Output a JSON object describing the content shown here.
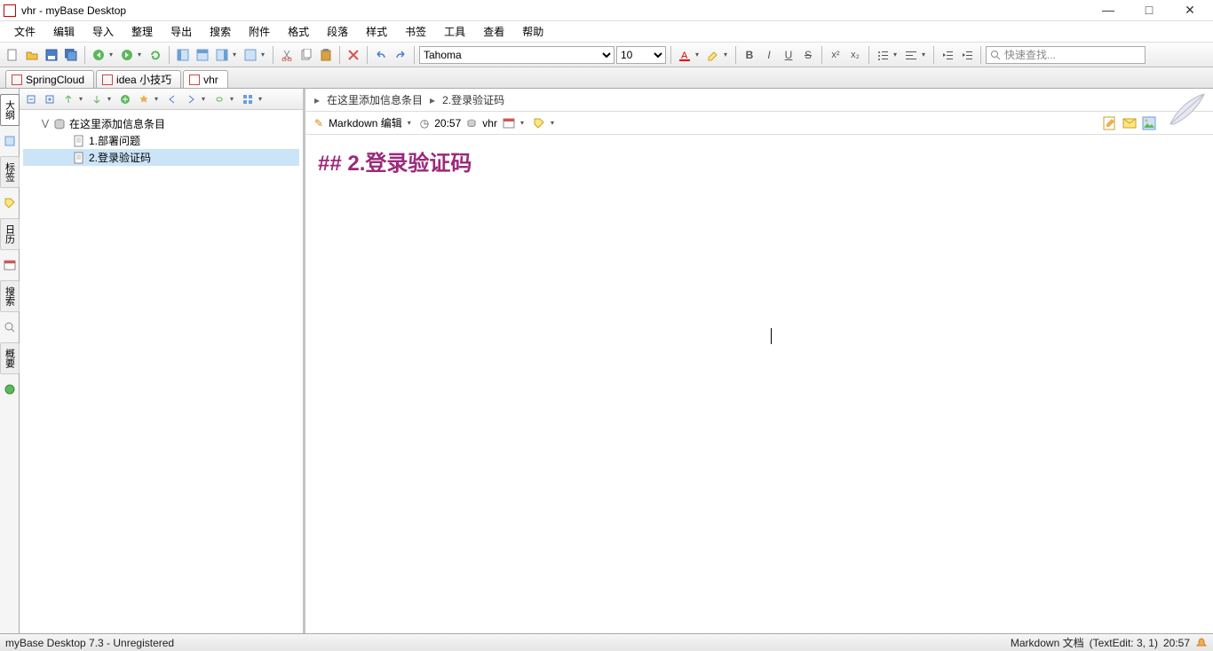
{
  "window": {
    "title": "vhr - myBase Desktop"
  },
  "menu": [
    "文件",
    "编辑",
    "导入",
    "整理",
    "导出",
    "搜索",
    "附件",
    "格式",
    "段落",
    "样式",
    "书签",
    "工具",
    "查看",
    "帮助"
  ],
  "toolbar": {
    "font_name": "Tahoma",
    "font_size": "10",
    "search_placeholder": "快速查找..."
  },
  "tabs": [
    {
      "label": "SpringCloud",
      "active": false
    },
    {
      "label": "idea 小技巧",
      "active": false
    },
    {
      "label": "vhr",
      "active": true
    }
  ],
  "sidebar_tabs": [
    "大纲",
    "标签",
    "日历",
    "搜索",
    "概要"
  ],
  "tree": {
    "root": "在这里添加信息条目",
    "items": [
      {
        "label": "1.部署问题",
        "selected": false
      },
      {
        "label": "2.登录验证码",
        "selected": true
      }
    ]
  },
  "breadcrumb": [
    "在这里添加信息条目",
    "2.登录验证码"
  ],
  "editor_bar": {
    "mode": "Markdown 编辑",
    "time": "20:57",
    "db": "vhr"
  },
  "document": {
    "heading": "## 2.登录验证码"
  },
  "statusbar": {
    "left": "myBase Desktop 7.3 - Unregistered",
    "doc_type": "Markdown 文档",
    "cursor": "(TextEdit: 3, 1)",
    "time": "20:57"
  }
}
